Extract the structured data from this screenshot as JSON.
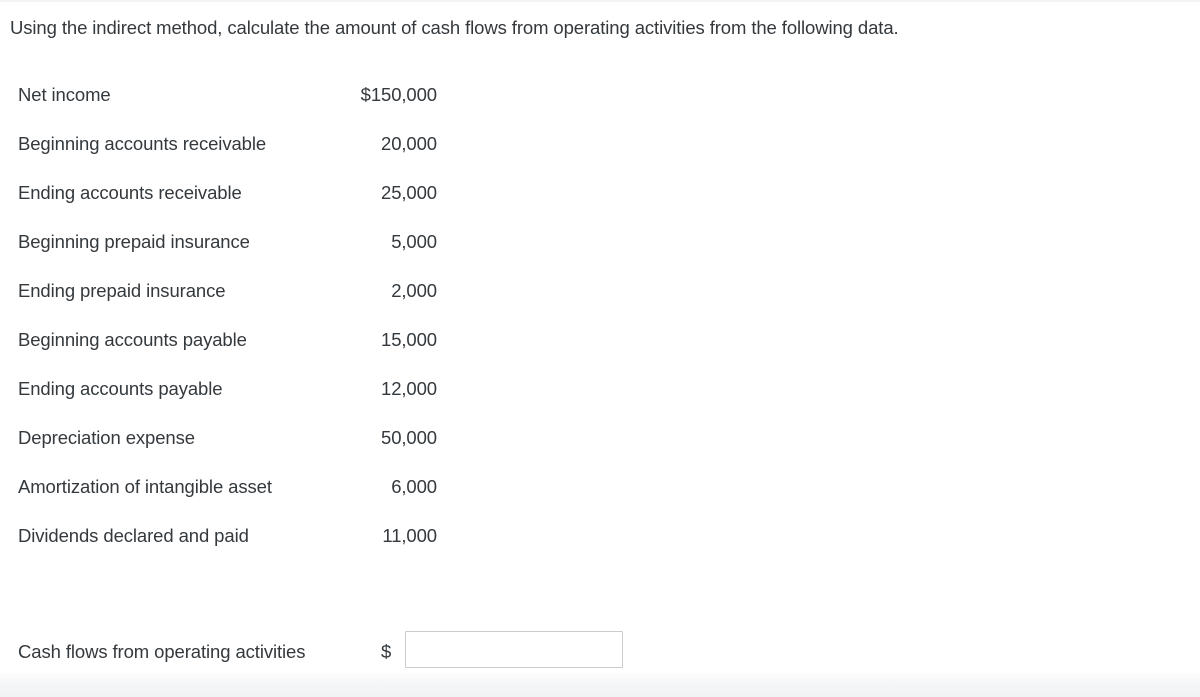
{
  "question": {
    "prompt": "Using the indirect method, calculate the amount of cash flows from operating activities from the following data."
  },
  "table": {
    "rows": [
      {
        "label": "Net income",
        "value": "$150,000"
      },
      {
        "label": "Beginning accounts receivable",
        "value": "20,000"
      },
      {
        "label": "Ending accounts receivable",
        "value": "25,000"
      },
      {
        "label": "Beginning prepaid insurance",
        "value": "5,000"
      },
      {
        "label": "Ending prepaid insurance",
        "value": "2,000"
      },
      {
        "label": "Beginning accounts payable",
        "value": "15,000"
      },
      {
        "label": "Ending accounts payable",
        "value": "12,000"
      },
      {
        "label": "Depreciation expense",
        "value": "50,000"
      },
      {
        "label": "Amortization of intangible asset",
        "value": "6,000"
      },
      {
        "label": "Dividends declared and paid",
        "value": "11,000"
      }
    ]
  },
  "answer": {
    "label": "Cash flows from operating activities",
    "currency_symbol": "$",
    "input_value": "",
    "input_placeholder": ""
  },
  "colors": {
    "text": "#34393d",
    "page_background": "#ffffff",
    "input_border": "#c9cbcc",
    "footer_band": "#f4f5f6"
  }
}
